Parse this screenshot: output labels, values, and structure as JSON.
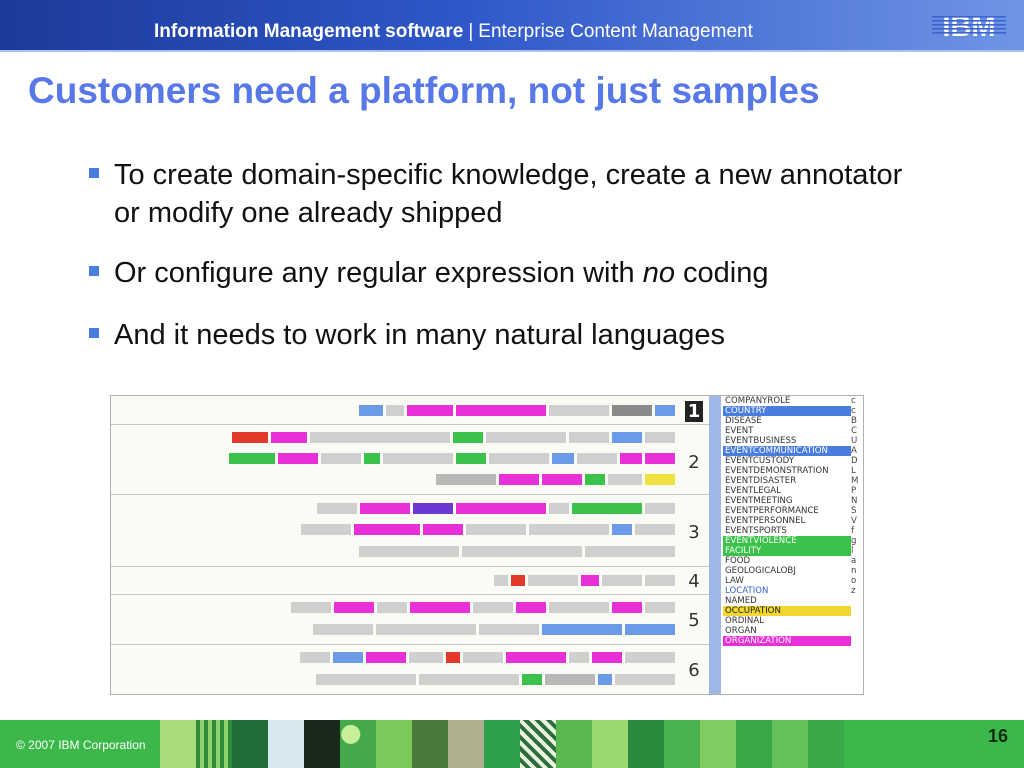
{
  "header": {
    "bold_text": "Information Management software",
    "separator": "|",
    "rest_text": "Enterprise Content Management",
    "logo": "IBM"
  },
  "title": "Customers need a platform, not just samples",
  "bullets": {
    "b1": "To create domain-specific knowledge, create a new annotator or modify one already shipped",
    "b2_before": "Or configure any regular expression with ",
    "b2_italic": "no",
    "b2_after": " coding",
    "b3": "And it needs to work in many natural languages"
  },
  "screenshot": {
    "row_numbers": [
      "1",
      "2",
      "3",
      "4",
      "5",
      "6"
    ],
    "type_list": [
      "COMPANYROLE",
      "COUNTRY",
      "DISEASE",
      "EVENT",
      "EVENTBUSINESS",
      "EVENTCOMMUNICATION",
      "EVENTCUSTODY",
      "EVENTDEMONSTRATION",
      "EVENTDISASTER",
      "EVENTLEGAL",
      "EVENTMEETING",
      "EVENTPERFORMANCE",
      "EVENTPERSONNEL",
      "EVENTSPORTS",
      "EVENTVIOLENCE",
      "FACILITY",
      "FOOD",
      "GEOLOGICALOBJ",
      "LAW",
      "LOCATION",
      "NAMED",
      "OCCUPATION",
      "ORDINAL",
      "ORGAN",
      "ORGANIZATION"
    ],
    "side_letters": [
      "c",
      "c",
      "",
      "",
      "B",
      "C",
      "U",
      "A",
      "D",
      "L",
      "M",
      "P",
      "N",
      "S",
      "V",
      "f",
      "",
      "g",
      "l",
      "a",
      "n",
      "o",
      "",
      "z",
      ""
    ],
    "colors": {
      "highlight_blue": "#4a7de0",
      "highlight_magenta": "#e830d8",
      "highlight_green": "#3ac24a",
      "highlight_yellow": "#f0d830"
    }
  },
  "footer": {
    "copyright": "© 2007 IBM Corporation",
    "page_number": "16"
  },
  "colors": {
    "header_blue": "#2f57c8",
    "title_blue": "#5878e8",
    "bullet_blue": "#4a7de0",
    "footer_green": "#3cb84a"
  }
}
